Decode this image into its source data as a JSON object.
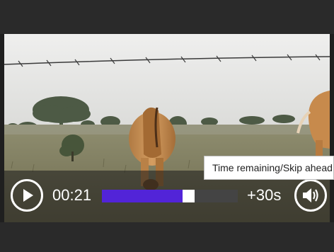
{
  "player": {
    "current_time": "00:21",
    "progress_fraction": 0.68,
    "skip_label": "+30s",
    "tooltip": "Time remaining/Skip ahead"
  },
  "colors": {
    "progress_fill": "#5224d8",
    "progress_track": "#444444",
    "thumb": "#ffffff",
    "chrome": "#2a2a2a"
  },
  "icons": {
    "play": "play-icon",
    "volume": "volume-icon"
  }
}
